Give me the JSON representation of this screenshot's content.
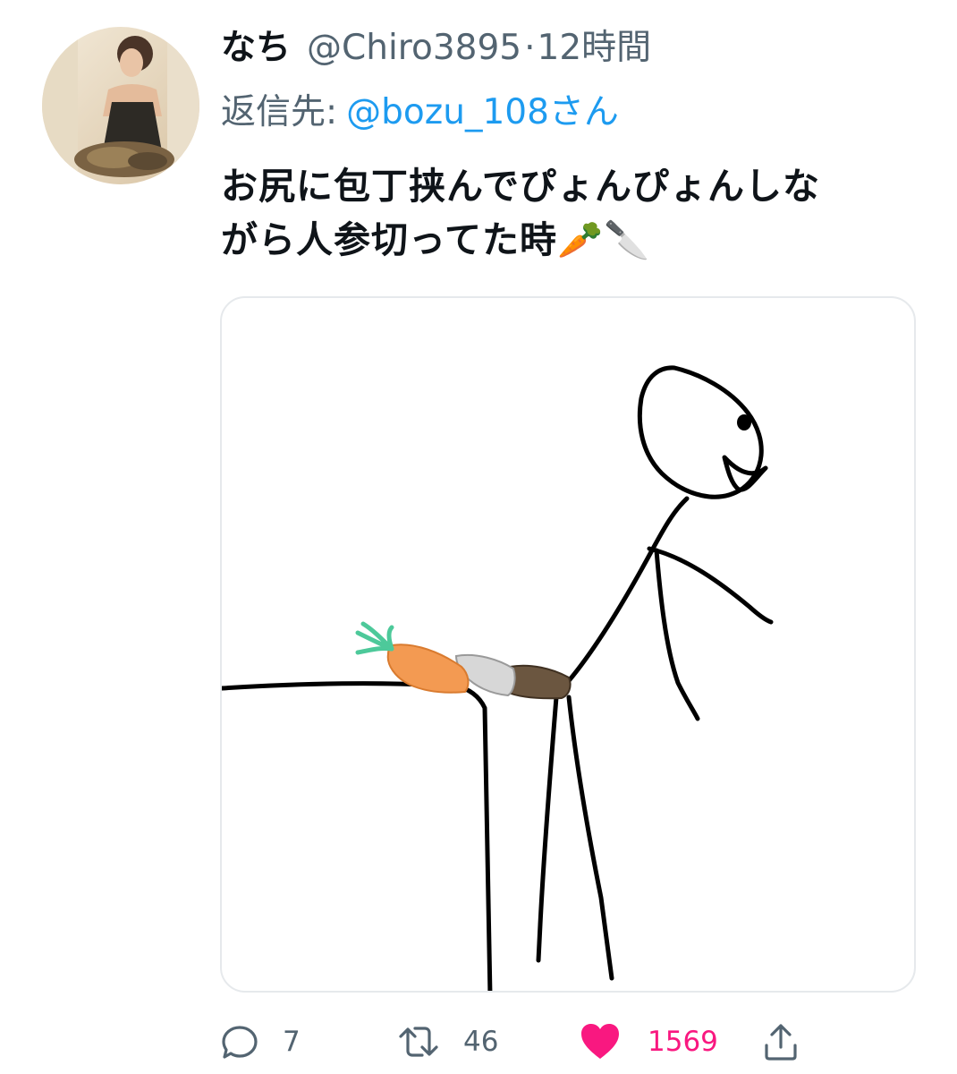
{
  "tweet": {
    "display_name": "なち",
    "handle": "@Chiro3895",
    "separator": "·",
    "time": "12時間",
    "reply_prefix": "返信先:",
    "reply_mention": "@bozu_108さん",
    "text_line1": "お尻に包丁挟んでぴょんぴょんしな",
    "text_line2": "がら人参切ってた時",
    "text_emoji": "🥕🔪"
  },
  "actions": {
    "reply_count": "7",
    "retweet_count": "46",
    "like_count": "1569"
  },
  "colors": {
    "text": "#0f1419",
    "secondary": "#536471",
    "link": "#1d9bf0",
    "like": "#f91880",
    "media_border": "#e6e9ec"
  },
  "icons": [
    "reply-icon",
    "retweet-icon",
    "heart-icon",
    "share-icon"
  ]
}
